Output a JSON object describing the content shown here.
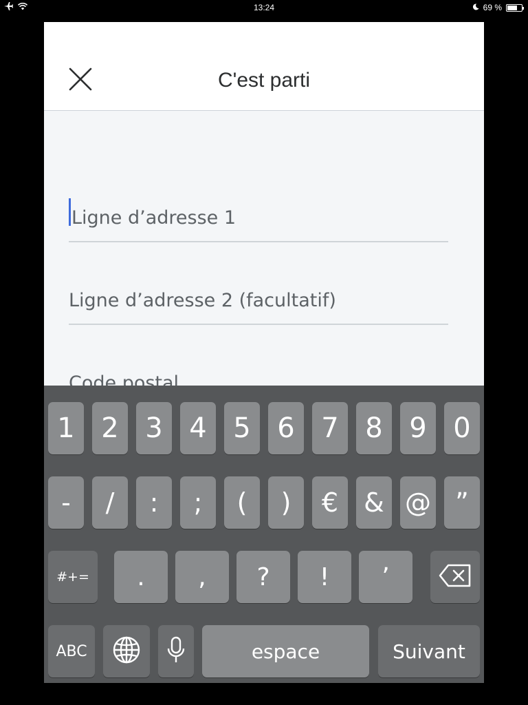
{
  "status_bar": {
    "time": "13:24",
    "battery_percent_label": "69 %",
    "battery_level": 0.69,
    "icons": [
      "airplane-icon",
      "wifi-icon",
      "moon-icon",
      "battery-icon"
    ]
  },
  "header": {
    "title": "C'est parti",
    "close_icon": "close-icon"
  },
  "form": {
    "address_line_1": {
      "placeholder": "Ligne d’adresse 1",
      "value": ""
    },
    "address_line_2": {
      "placeholder": "Ligne d’adresse 2 (facultatif)",
      "value": ""
    },
    "postal_code": {
      "placeholder": "Code postal",
      "value": ""
    }
  },
  "keyboard": {
    "row1": [
      "1",
      "2",
      "3",
      "4",
      "5",
      "6",
      "7",
      "8",
      "9",
      "0"
    ],
    "row2": [
      "-",
      "/",
      ":",
      ";",
      "(",
      ")",
      "€",
      "&",
      "@",
      "”"
    ],
    "row3": {
      "symbols_key": "#+=",
      "keys": [
        ".",
        ",",
        "?",
        "!",
        "’"
      ],
      "delete_icon": "backspace-icon"
    },
    "row4": {
      "abc_key": "ABC",
      "globe_icon": "globe-icon",
      "mic_icon": "microphone-icon",
      "space_key": "espace",
      "next_key": "Suivant"
    }
  },
  "colors": {
    "cursor": "#3f6bdc",
    "keyboard_bg": "#555759",
    "key_bg": "#8a8c8e"
  }
}
